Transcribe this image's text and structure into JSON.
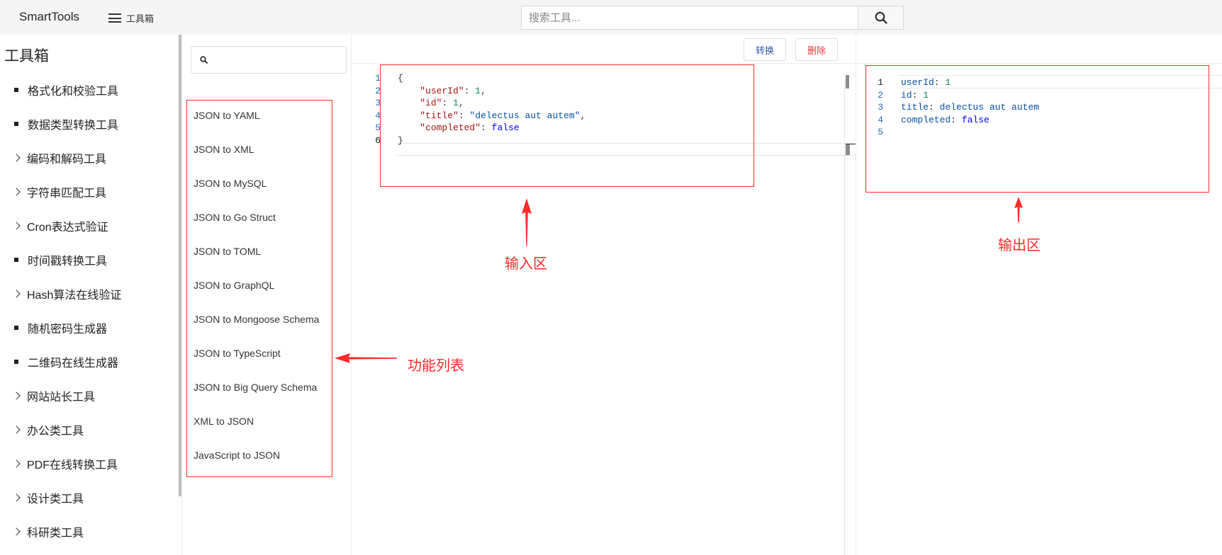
{
  "header": {
    "brand": "SmartTools",
    "menu_label": "工具箱",
    "search_placeholder": "搜索工具..."
  },
  "sidebar": {
    "title": "工具箱",
    "items": [
      {
        "label": "格式化和校验工具",
        "marker": "bullet"
      },
      {
        "label": "数据类型转换工具",
        "marker": "bullet"
      },
      {
        "label": "编码和解码工具",
        "marker": "chevron"
      },
      {
        "label": "字符串匹配工具",
        "marker": "chevron"
      },
      {
        "label": "Cron表达式验证",
        "marker": "chevron"
      },
      {
        "label": "时间戳转换工具",
        "marker": "bullet"
      },
      {
        "label": "Hash算法在线验证",
        "marker": "chevron"
      },
      {
        "label": "随机密码生成器",
        "marker": "bullet"
      },
      {
        "label": "二维码在线生成器",
        "marker": "bullet"
      },
      {
        "label": "网站站长工具",
        "marker": "chevron"
      },
      {
        "label": "办公类工具",
        "marker": "chevron"
      },
      {
        "label": "PDF在线转换工具",
        "marker": "chevron"
      },
      {
        "label": "设计类工具",
        "marker": "chevron"
      },
      {
        "label": "科研类工具",
        "marker": "chevron"
      }
    ]
  },
  "functions": {
    "search_value": "",
    "items": [
      "JSON to YAML",
      "JSON to XML",
      "JSON to MySQL",
      "JSON to Go Struct",
      "JSON to TOML",
      "JSON to GraphQL",
      "JSON to Mongoose Schema",
      "JSON to TypeScript",
      "JSON to Big Query Schema",
      "XML to JSON",
      "JavaScript to JSON"
    ]
  },
  "editor": {
    "convert_label": "转换",
    "delete_label": "删除",
    "input_lines": [
      {
        "n": "1",
        "text": "{"
      },
      {
        "n": "2",
        "key": "\"userId\"",
        "value": "1",
        "vtype": "num",
        "comma": true
      },
      {
        "n": "3",
        "key": "\"id\"",
        "value": "1",
        "vtype": "num",
        "comma": true
      },
      {
        "n": "4",
        "key": "\"title\"",
        "value": "\"delectus aut autem\"",
        "vtype": "str",
        "comma": true
      },
      {
        "n": "5",
        "key": "\"completed\"",
        "value": "false",
        "vtype": "bool",
        "comma": false
      },
      {
        "n": "6",
        "text": "}"
      }
    ],
    "output_lines": [
      {
        "n": "1",
        "key": "userId",
        "value": "1",
        "vtype": "num"
      },
      {
        "n": "2",
        "key": "id",
        "value": "1",
        "vtype": "num"
      },
      {
        "n": "3",
        "key": "title",
        "value": "delectus aut autem",
        "vtype": "str"
      },
      {
        "n": "4",
        "key": "completed",
        "value": "false",
        "vtype": "bool"
      },
      {
        "n": "5"
      }
    ]
  },
  "annotations": {
    "input_area": "输入区",
    "output_area": "输出区",
    "function_list": "功能列表",
    "color": "#ff2a2a"
  }
}
